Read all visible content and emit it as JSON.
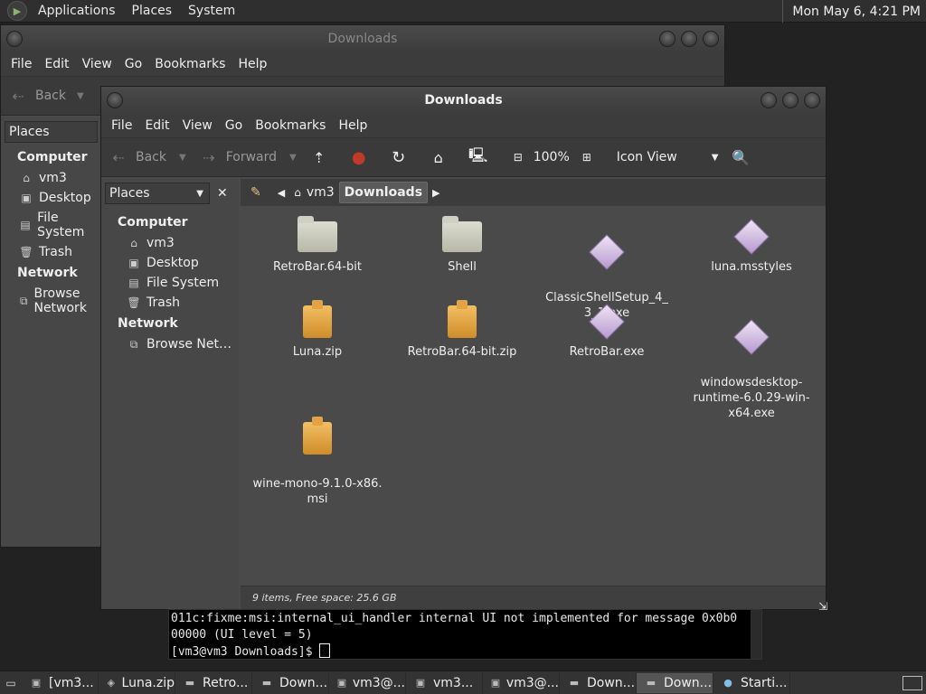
{
  "top_panel": {
    "menus": [
      "Applications",
      "Places",
      "System"
    ],
    "clock": "Mon May  6,  4:21 PM"
  },
  "back_window": {
    "title": "Downloads",
    "menu": [
      "File",
      "Edit",
      "View",
      "Go",
      "Bookmarks",
      "Help"
    ],
    "back_label": "Back",
    "places_label": "Places",
    "sidebar": {
      "computer": "Computer",
      "items": [
        "vm3",
        "Desktop",
        "File System",
        "Trash"
      ],
      "network": "Network",
      "network_items": [
        "Browse Network"
      ]
    }
  },
  "front_window": {
    "title": "Downloads",
    "menu": [
      "File",
      "Edit",
      "View",
      "Go",
      "Bookmarks",
      "Help"
    ],
    "toolbar": {
      "back": "Back",
      "forward": "Forward",
      "zoom": "100%",
      "view_mode": "Icon View"
    },
    "places_label": "Places",
    "sidebar": {
      "computer": "Computer",
      "items": [
        "vm3",
        "Desktop",
        "File System",
        "Trash"
      ],
      "network": "Network",
      "network_items": [
        "Browse Net…"
      ]
    },
    "path": [
      "vm3",
      "Downloads"
    ],
    "files": [
      {
        "name": "RetroBar.64-bit",
        "type": "folder"
      },
      {
        "name": "Shell",
        "type": "folder"
      },
      {
        "name": "ClassicShellSetup_4_\n3_1.exe",
        "type": "exe"
      },
      {
        "name": "luna.msstyles",
        "type": "exe"
      },
      {
        "name": "Luna.zip",
        "type": "zip"
      },
      {
        "name": "RetroBar.64-bit.zip",
        "type": "zip"
      },
      {
        "name": "RetroBar.exe",
        "type": "exe"
      },
      {
        "name": "windowsdesktop-\nruntime-6.0.29-win-\nx64.exe",
        "type": "exe"
      },
      {
        "name": "wine-mono-9.1.0-x86.\nmsi",
        "type": "zip"
      }
    ],
    "status": "9 items, Free space: 25.6 GB"
  },
  "terminal": {
    "lines": [
      "011c:fixme:msi:internal_ui_handler internal UI not implemented for message 0x0b0",
      "00000 (UI level = 5)"
    ],
    "prompt": "[vm3@vm3 Downloads]$ "
  },
  "taskbar": {
    "tasks": [
      "[vm3...",
      "Luna.zip",
      "Retro...",
      "Down...",
      "vm3@...",
      "vm3...",
      "vm3@...",
      "Down...",
      "Down...",
      "Starti..."
    ]
  }
}
